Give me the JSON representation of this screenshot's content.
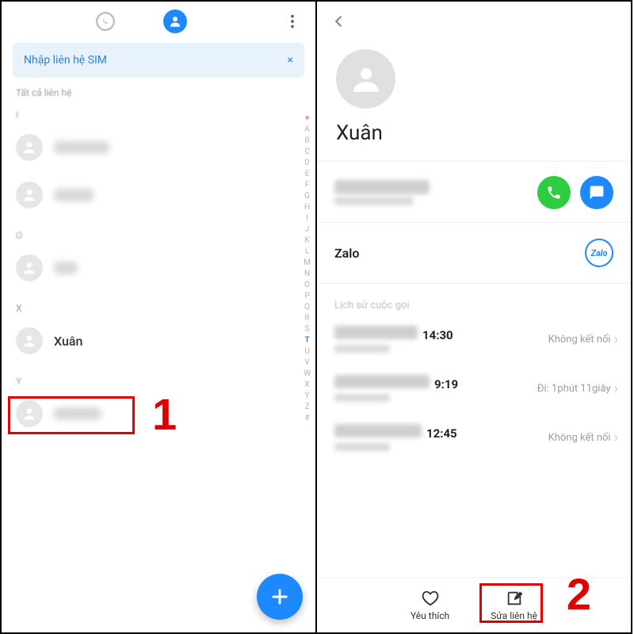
{
  "left": {
    "sim_banner": "Nhập liên hệ SIM",
    "filter_label": "Tất cả liên hệ",
    "sections": {
      "x": "X",
      "y": "Y"
    },
    "contact_xuan": "Xuân",
    "alpha": [
      "A",
      "B",
      "C",
      "D",
      "E",
      "F",
      "G",
      "H",
      "I",
      "J",
      "K",
      "L",
      "M",
      "N",
      "O",
      "P",
      "Q",
      "R",
      "S",
      "T",
      "U",
      "V",
      "W",
      "X",
      "Y",
      "Z",
      "#"
    ]
  },
  "right": {
    "name": "Xuân",
    "zalo": "Zalo",
    "zalo_logo": "Zalo",
    "history_label": "Lịch sử cuộc gọi",
    "calls": [
      {
        "time": "14:30",
        "status": "Không kết nối"
      },
      {
        "time": "9:19",
        "status": "Đi: 1phút 11giây"
      },
      {
        "time": "12:45",
        "status": "Không kết nối"
      }
    ],
    "bottom": {
      "fav": "Yêu thích",
      "edit": "Sửa liên hệ"
    }
  },
  "annotations": {
    "one": "1",
    "two": "2"
  }
}
